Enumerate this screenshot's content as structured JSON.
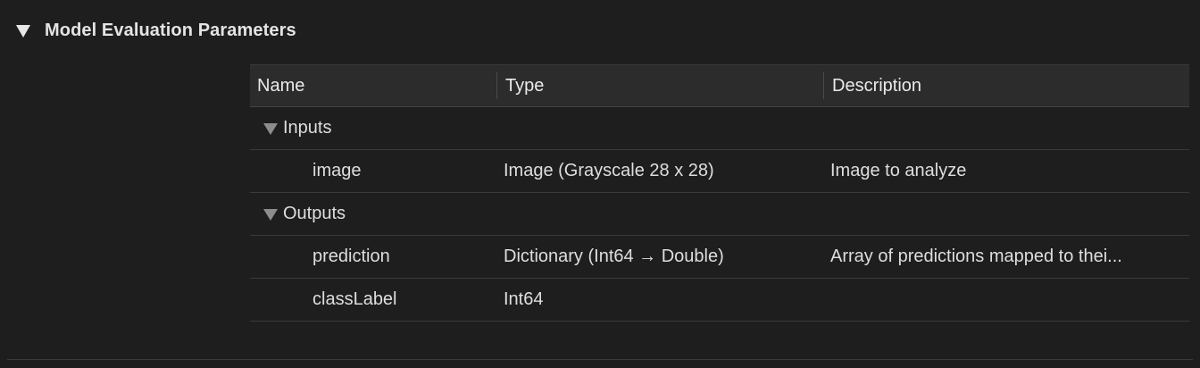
{
  "section": {
    "title": "Model Evaluation Parameters",
    "disclosure_icon": "disclosure-triangle-down-icon"
  },
  "table": {
    "columns": [
      "Name",
      "Type",
      "Description"
    ],
    "groups": [
      {
        "label": "Inputs",
        "rows": [
          {
            "name": "image",
            "type": "Image (Grayscale 28 x 28)",
            "description": "Image to analyze"
          }
        ]
      },
      {
        "label": "Outputs",
        "rows": [
          {
            "name": "prediction",
            "type": "Dictionary (Int64 → Double)",
            "description": "Array of predictions mapped to thei..."
          },
          {
            "name": "classLabel",
            "type": "Int64",
            "description": ""
          }
        ]
      }
    ]
  }
}
